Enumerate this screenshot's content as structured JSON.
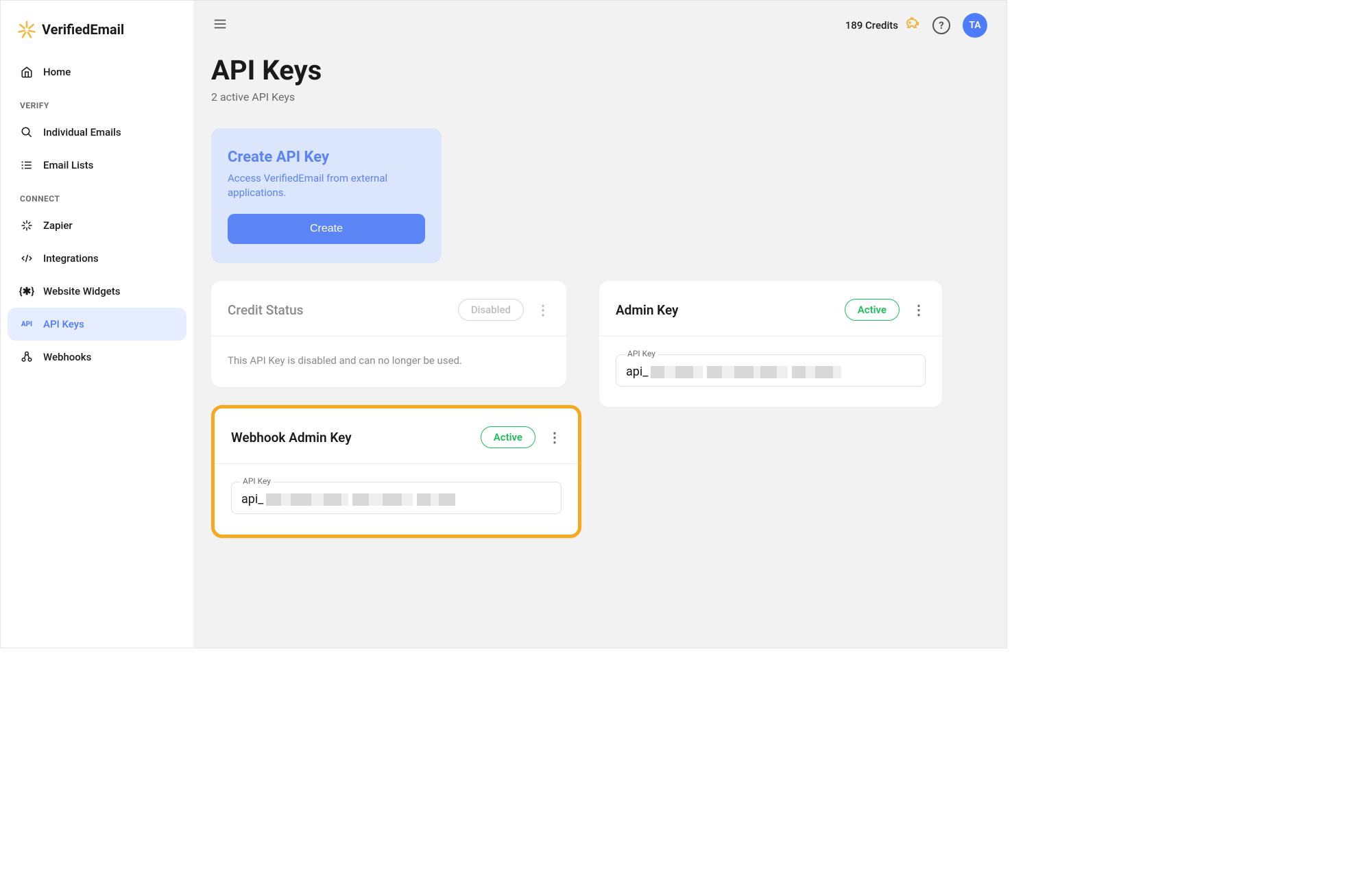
{
  "brand": {
    "name": "VerifiedEmail"
  },
  "sidebar": {
    "home": "Home",
    "sections": {
      "verify": {
        "label": "VERIFY",
        "items": [
          "Individual Emails",
          "Email Lists"
        ]
      },
      "connect": {
        "label": "CONNECT",
        "items": [
          "Zapier",
          "Integrations",
          "Website Widgets",
          "API Keys",
          "Webhooks"
        ]
      }
    },
    "active": "API Keys"
  },
  "topbar": {
    "credits_text": "189 Credits",
    "avatar_initials": "TA"
  },
  "page": {
    "title": "API Keys",
    "subtitle": "2 active API Keys"
  },
  "create_card": {
    "title": "Create API Key",
    "description": "Access VerifiedEmail from external applications.",
    "button": "Create"
  },
  "keys": {
    "credit_status": {
      "title": "Credit Status",
      "badge": "Disabled",
      "body": "This API Key is disabled and can no longer be used."
    },
    "admin_key": {
      "title": "Admin Key",
      "badge": "Active",
      "field_label": "API Key",
      "prefix": "api_"
    },
    "webhook_admin_key": {
      "title": "Webhook Admin Key",
      "badge": "Active",
      "field_label": "API Key",
      "prefix": "api_"
    }
  }
}
